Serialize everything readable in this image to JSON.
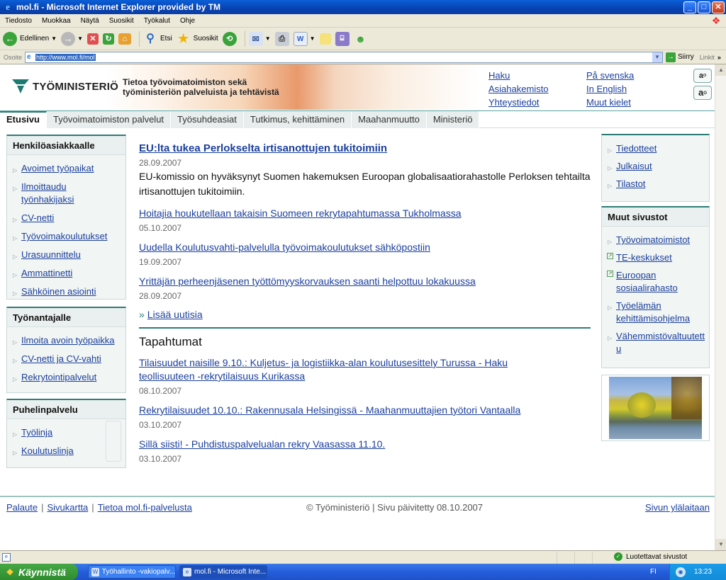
{
  "window": {
    "title": "mol.fi - Microsoft Internet Explorer provided by TM",
    "controls": {
      "minimize": "_",
      "maximize": "□",
      "close": "✕"
    }
  },
  "menu": [
    "Tiedosto",
    "Muokkaa",
    "Näytä",
    "Suosikit",
    "Työkalut",
    "Ohje"
  ],
  "toolbar": {
    "back_label": "Edellinen",
    "search_label": "Etsi",
    "favorites_label": "Suosikit"
  },
  "address": {
    "label": "Osoite",
    "url": "http://www.mol.fi/mol",
    "go_label": "Siirry",
    "links_label": "Linkit"
  },
  "header": {
    "logo_text": "TYÖMINISTERIÖ",
    "tagline_line1": "Tietoa työvoimatoimiston sekä",
    "tagline_line2": "työministeriön palveluista ja tehtävistä",
    "links_col1": [
      "Haku",
      "Asiahakemisto",
      "Yhteystiedot"
    ],
    "links_col2": [
      "På svenska",
      "In English",
      "Muut kielet"
    ],
    "font_small": "a",
    "font_large": "a"
  },
  "nav": {
    "tabs": [
      "Etusivu",
      "Työvoimatoimiston palvelut",
      "Työsuhdeasiat",
      "Tutkimus, kehittäminen",
      "Maahanmuutto",
      "Ministeriö"
    ]
  },
  "left": {
    "box1_title": "Henkilöasiakkaalle",
    "box1_items": [
      "Avoimet työpaikat",
      "Ilmoittaudu työnhakijaksi",
      "CV-netti",
      "Työvoimakoulutukset",
      "Urasuunnittelu",
      "Ammattinetti",
      "Sähköinen asiointi"
    ],
    "box2_title": "Työnantajalle",
    "box2_items": [
      "Ilmoita avoin työpaikka",
      "CV-netti ja CV-vahti",
      "Rekrytointipalvelut"
    ],
    "box3_title": "Puhelinpalvelu",
    "box3_items": [
      "Työlinja",
      "Koulutuslinja"
    ]
  },
  "main": {
    "news": [
      {
        "title": "EU:lta tukea Perlokselta irtisanottujen tukitoimiin",
        "date": "28.09.2007",
        "text": "EU-komissio on hyväksynyt Suomen hakemuksen Euroopan globalisaatiorahastolle Perloksen tehtailta irtisanottujen tukitoimiin."
      },
      {
        "title": "Hoitajia houkutellaan takaisin Suomeen rekrytapahtumassa Tukholmassa",
        "date": "05.10.2007"
      },
      {
        "title": "Uudella Koulutusvahti-palvelulla työvoimakoulutukset sähköpostiin",
        "date": "19.09.2007"
      },
      {
        "title": "Yrittäjän perheenjäsenen työttömyyskorvauksen saanti helpottuu lokakuussa",
        "date": "28.09.2007"
      }
    ],
    "more_marker": "»",
    "more_label": "Lisää uutisia",
    "events_title": "Tapahtumat",
    "events": [
      {
        "title": "Tilaisuudet naisille 9.10.: Kuljetus- ja logistiikka-alan koulutusesittely Turussa - Haku teollisuuteen -rekrytilaisuus Kurikassa",
        "date": "08.10.2007"
      },
      {
        "title": "Rekrytilaisuudet 10.10.: Rakennusala Helsingissä - Maahanmuuttajien työtori Vantaalla",
        "date": "03.10.2007"
      },
      {
        "title": "Sillä siisti! - Puhdistuspalvelualan rekry Vaasassa 11.10.",
        "date": "03.10.2007"
      }
    ]
  },
  "right": {
    "box1_items": [
      "Tiedotteet",
      "Julkaisut",
      "Tilastot"
    ],
    "box2_title": "Muut sivustot",
    "box2_items": [
      "Työvoimatoimistot",
      "TE-keskukset",
      "Euroopan sosiaalirahasto",
      "Työelämän kehittämisohjelma",
      "Vähemmistövaltuutettu"
    ]
  },
  "footer": {
    "links": [
      "Palaute",
      "Sivukartta",
      "Tietoa mol.fi-palvelusta"
    ],
    "copyright": "© Työministeriö | Sivu päivitetty 08.10.2007",
    "top_link": "Sivun ylälaitaan"
  },
  "status": {
    "zone": "Luotettavat sivustot"
  },
  "taskbar": {
    "start_label": "Käynnistä",
    "tasks": [
      "Työhallinto -vakiopalv...",
      "mol.fi - Microsoft Inte..."
    ],
    "lang": "FI",
    "clock": "13:23"
  },
  "colors": {
    "accent": "#2d7c76",
    "link": "#1b3f9c"
  }
}
